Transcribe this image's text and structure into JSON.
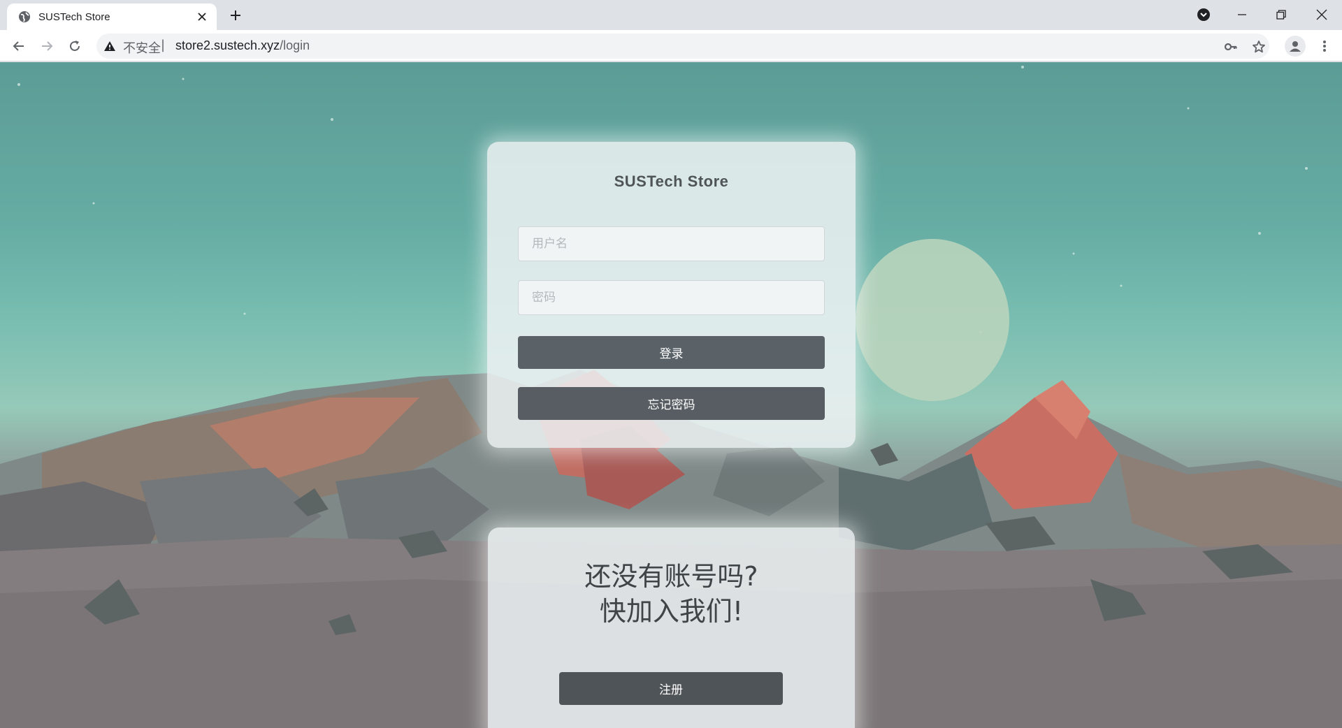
{
  "browser": {
    "tab_title": "SUSTech Store",
    "security_label": "不安全",
    "separator": "|",
    "url_host": "store2.sustech.xyz",
    "url_path": "/login"
  },
  "page": {
    "store_title": "SUSTech Store",
    "username_placeholder": "用户名",
    "password_placeholder": "密码",
    "login_label": "登录",
    "forgot_label": "忘记密码",
    "signup_prompt_line1": "还没有账号吗?",
    "signup_prompt_line2": "快加入我们!",
    "signup_label": "注册"
  },
  "colors": {
    "button": "#5a6268",
    "card": "#eef2f3",
    "sky": "#66ada4"
  },
  "icons": [
    "globe-icon",
    "close-icon",
    "plus-icon",
    "back-icon",
    "forward-icon",
    "reload-icon",
    "warning-icon",
    "key-icon",
    "star-icon",
    "profile-icon",
    "menu-icon",
    "minimize-icon",
    "restore-icon"
  ]
}
